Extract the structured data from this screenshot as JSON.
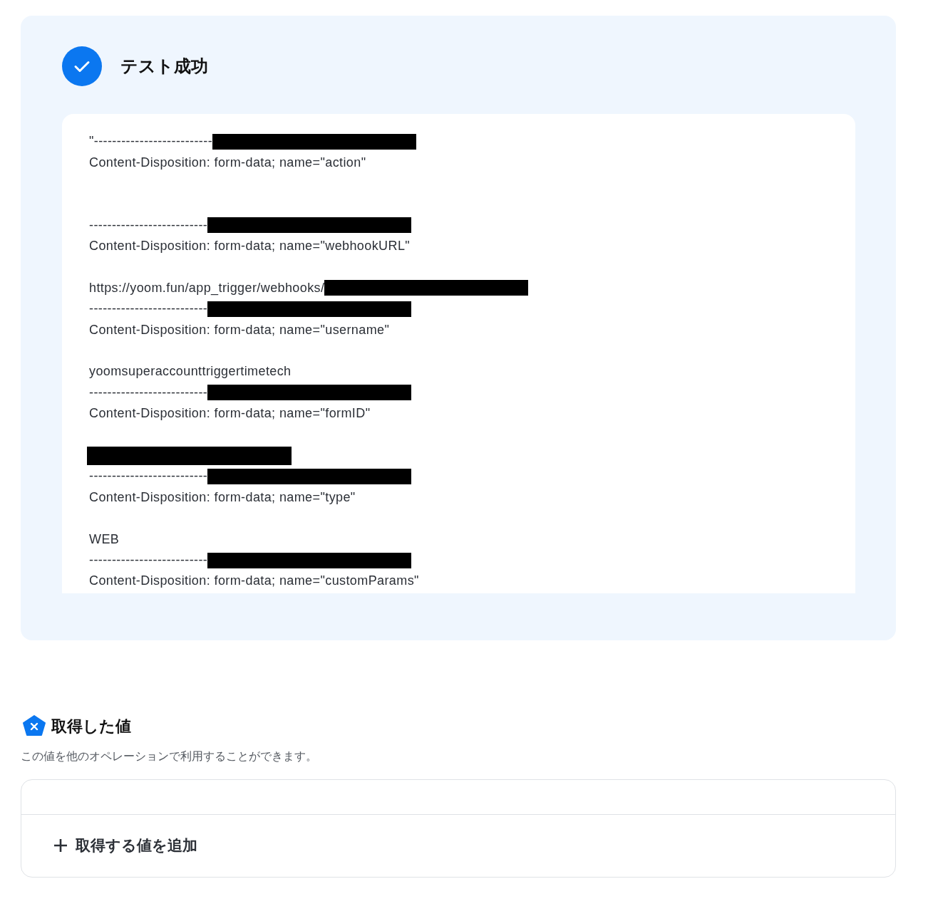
{
  "result": {
    "title": "テスト成功",
    "lines": [
      {
        "kind": "text",
        "text": "\"--------------------------",
        "redacted": true
      },
      {
        "kind": "text",
        "text": "Content-Disposition: form-data; name=\"action\"",
        "redacted": false
      },
      {
        "kind": "blank"
      },
      {
        "kind": "blank"
      },
      {
        "kind": "text",
        "text": "--------------------------",
        "redacted": true
      },
      {
        "kind": "text",
        "text": "Content-Disposition: form-data; name=\"webhookURL\"",
        "redacted": false
      },
      {
        "kind": "blank"
      },
      {
        "kind": "text",
        "text": "https://yoom.fun/app_trigger/webhooks/",
        "redacted": true
      },
      {
        "kind": "text",
        "text": "--------------------------",
        "redacted": true
      },
      {
        "kind": "text",
        "text": "Content-Disposition: form-data; name=\"username\"",
        "redacted": false
      },
      {
        "kind": "blank"
      },
      {
        "kind": "text",
        "text": "yoomsuperaccounttriggertimetech",
        "redacted": false
      },
      {
        "kind": "text",
        "text": "--------------------------",
        "redacted": true
      },
      {
        "kind": "text",
        "text": "Content-Disposition: form-data; name=\"formID\"",
        "redacted": false
      },
      {
        "kind": "blank"
      },
      {
        "kind": "redacted"
      },
      {
        "kind": "text",
        "text": "--------------------------",
        "redacted": true
      },
      {
        "kind": "text",
        "text": "Content-Disposition: form-data; name=\"type\"",
        "redacted": false
      },
      {
        "kind": "blank"
      },
      {
        "kind": "text",
        "text": "WEB",
        "redacted": false
      },
      {
        "kind": "text",
        "text": "--------------------------",
        "redacted": true
      },
      {
        "kind": "text",
        "text": "Content-Disposition: form-data; name=\"customParams\"",
        "redacted": false
      }
    ]
  },
  "values": {
    "title": "取得した値",
    "description": "この値を他のオペレーションで利用することができます。",
    "add_button": "取得する値を追加"
  }
}
